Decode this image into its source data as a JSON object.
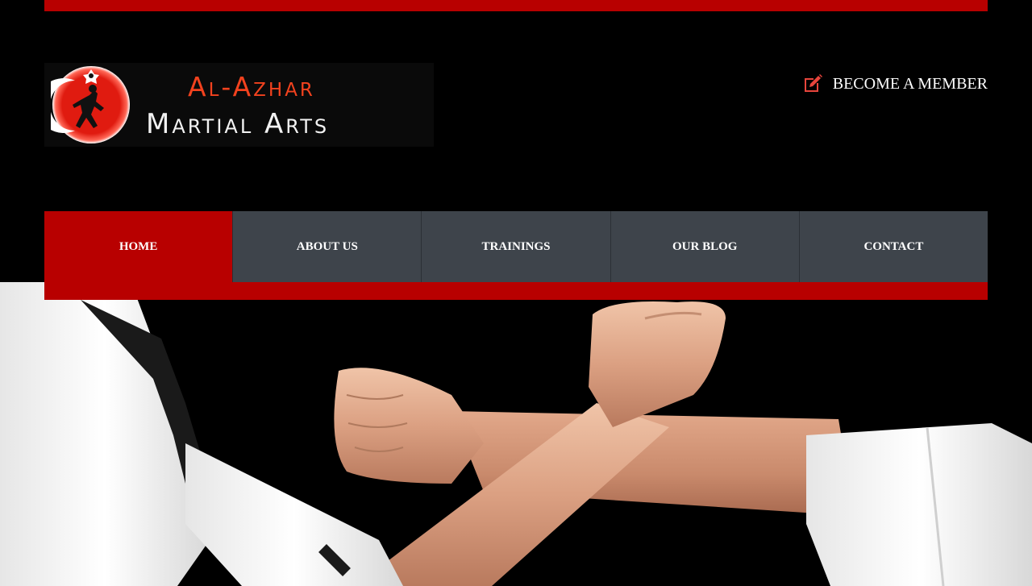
{
  "logo": {
    "line1": "Al-Azhar",
    "line2": "Martial Arts",
    "emblem_icon": "martial-artist-crescent-emblem"
  },
  "header": {
    "member_label": "BECOME A MEMBER",
    "member_icon": "edit-pencil-icon"
  },
  "nav": {
    "items": [
      {
        "label": "HOME",
        "active": true
      },
      {
        "label": "ABOUT US",
        "active": false
      },
      {
        "label": "TRAININGS",
        "active": false
      },
      {
        "label": "OUR BLOG",
        "active": false
      },
      {
        "label": "CONTACT",
        "active": false
      }
    ]
  },
  "colors": {
    "accent": "#b80000",
    "nav_bg": "#3e444b",
    "logo_red": "#f2421e",
    "background": "#000000"
  }
}
